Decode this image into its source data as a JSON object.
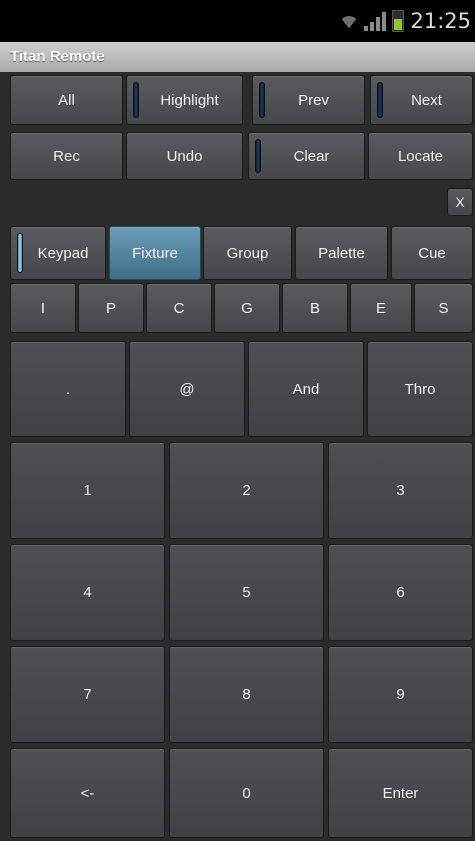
{
  "status": {
    "time": "21:25"
  },
  "app": {
    "title": "Titan Remote"
  },
  "row1": [
    "All",
    "Highlight",
    "Prev",
    "Next"
  ],
  "row2": [
    "Rec",
    "Undo",
    "Clear",
    "Locate"
  ],
  "close_label": "X",
  "modes": [
    "Keypad",
    "Fixture",
    "Group",
    "Palette",
    "Cue"
  ],
  "letters": [
    "I",
    "P",
    "C",
    "G",
    "B",
    "E",
    "S"
  ],
  "ops": [
    ".",
    "@",
    "And",
    "Thro"
  ],
  "keys": {
    "k1": "1",
    "k2": "2",
    "k3": "3",
    "k4": "4",
    "k5": "5",
    "k6": "6",
    "k7": "7",
    "k8": "8",
    "k9": "9",
    "back": "<-",
    "k0": "0",
    "enter": "Enter"
  },
  "colors": {
    "accent": "#4f87aa",
    "selected": "#5a8aa3",
    "panel": "#2a2b2d"
  }
}
